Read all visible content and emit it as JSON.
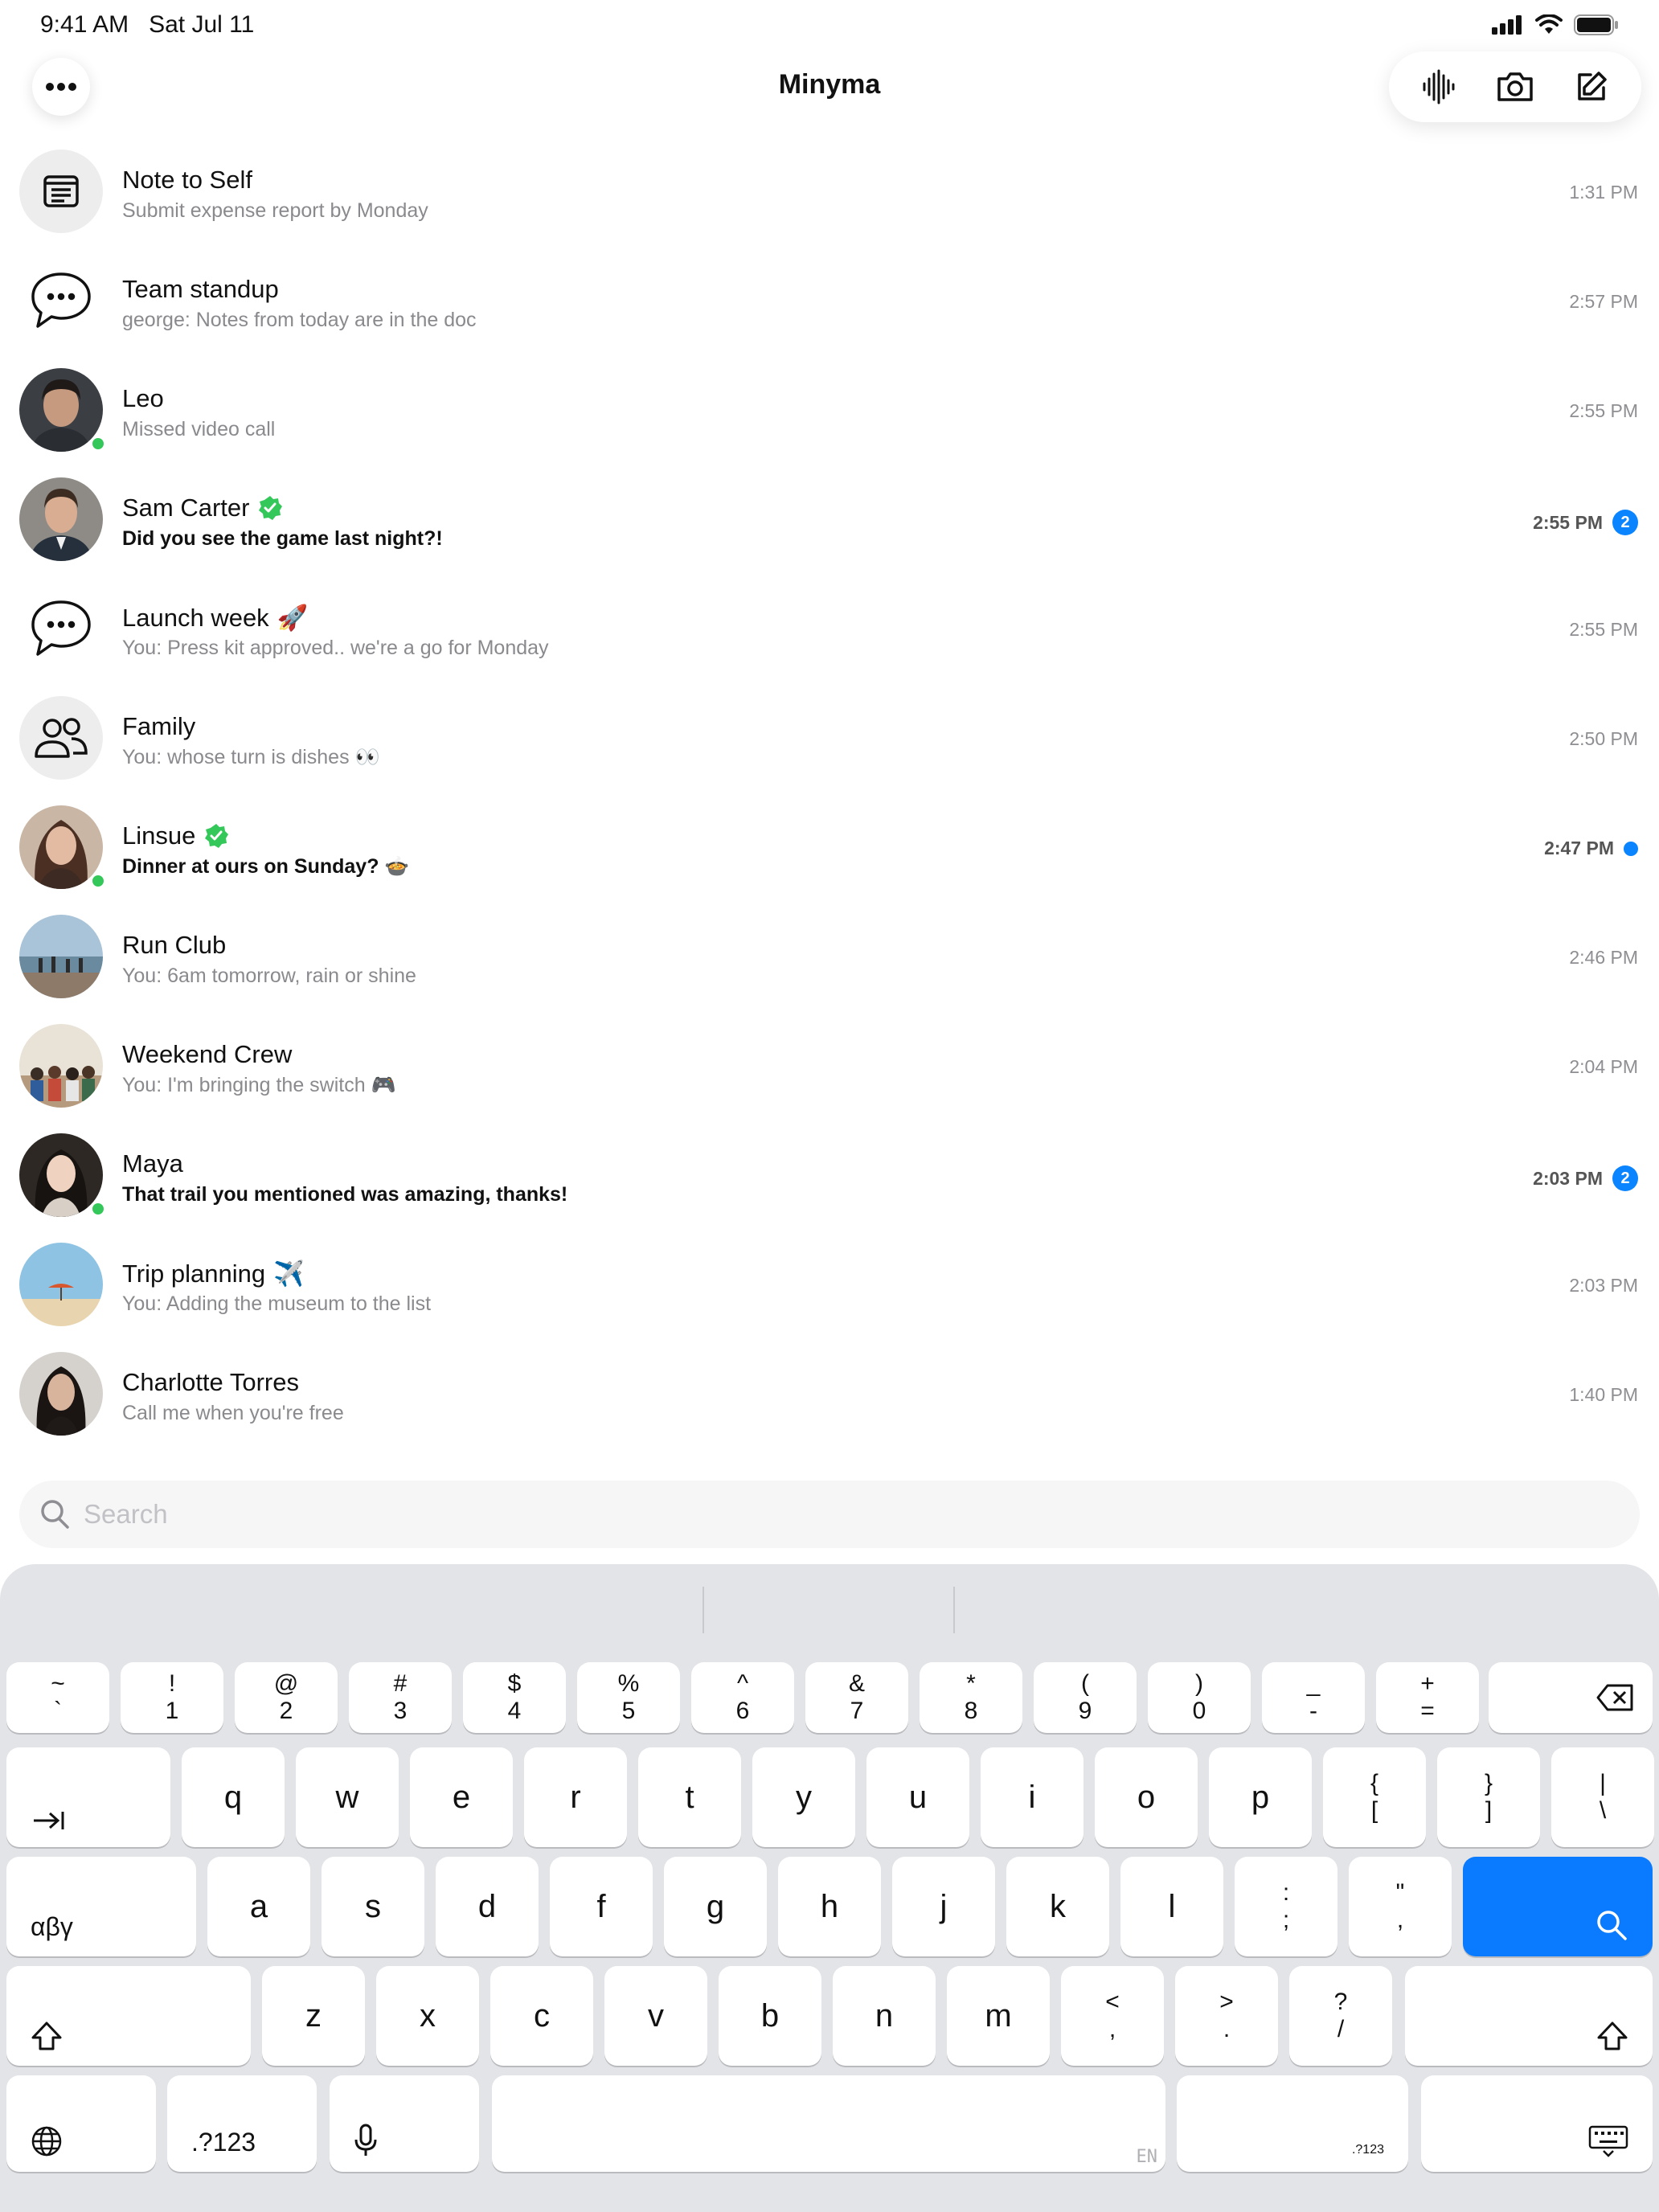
{
  "status_bar": {
    "time": "9:41 AM",
    "date": "Sat Jul 11"
  },
  "header": {
    "title": "Minyma",
    "menu_icon": "more-horizontal-icon",
    "toolbar_icons": [
      "waveform-icon",
      "camera-icon",
      "compose-icon"
    ]
  },
  "chats": [
    {
      "name": "Note to Self",
      "emoji": "",
      "preview": "Submit expense report by Monday",
      "time": "1:31 PM",
      "unread_count": "",
      "unread_dot": false,
      "verified": false,
      "online": false,
      "avatar": "note-icon",
      "bold": false
    },
    {
      "name": "Team standup",
      "emoji": "",
      "preview": "george: Notes from today are in the doc",
      "time": "2:57 PM",
      "unread_count": "",
      "unread_dot": false,
      "verified": false,
      "online": false,
      "avatar": "chat-bubble-icon",
      "bold": false
    },
    {
      "name": "Leo",
      "emoji": "",
      "preview": "Missed video call",
      "time": "2:55 PM",
      "unread_count": "",
      "unread_dot": false,
      "verified": false,
      "online": true,
      "avatar": "photo",
      "bold": false
    },
    {
      "name": "Sam Carter",
      "emoji": "",
      "preview": "Did you see the game last night?!",
      "time": "2:55 PM",
      "unread_count": "2",
      "unread_dot": false,
      "verified": true,
      "online": false,
      "avatar": "photo",
      "bold": true
    },
    {
      "name": "Launch week",
      "emoji": "🚀",
      "preview": "You: Press kit approved.. we're a go for Monday",
      "time": "2:55 PM",
      "unread_count": "",
      "unread_dot": false,
      "verified": false,
      "online": false,
      "avatar": "chat-bubble-icon",
      "bold": false
    },
    {
      "name": "Family",
      "emoji": "",
      "preview": "You: whose turn is dishes 👀",
      "time": "2:50 PM",
      "unread_count": "",
      "unread_dot": false,
      "verified": false,
      "online": false,
      "avatar": "group-icon",
      "bold": false
    },
    {
      "name": "Linsue",
      "emoji": "",
      "preview": "Dinner at ours on Sunday? 🍲",
      "time": "2:47 PM",
      "unread_count": "",
      "unread_dot": true,
      "verified": true,
      "online": true,
      "avatar": "photo",
      "bold": true
    },
    {
      "name": "Run Club",
      "emoji": "",
      "preview": "You: 6am tomorrow, rain or shine",
      "time": "2:46 PM",
      "unread_count": "",
      "unread_dot": false,
      "verified": false,
      "online": false,
      "avatar": "photo",
      "bold": false
    },
    {
      "name": "Weekend Crew",
      "emoji": "",
      "preview": "You: I'm bringing the switch 🎮",
      "time": "2:04 PM",
      "unread_count": "",
      "unread_dot": false,
      "verified": false,
      "online": false,
      "avatar": "photo",
      "bold": false
    },
    {
      "name": "Maya",
      "emoji": "",
      "preview": "That trail you mentioned was amazing, thanks!",
      "time": "2:03 PM",
      "unread_count": "2",
      "unread_dot": false,
      "verified": false,
      "online": true,
      "avatar": "photo",
      "bold": true
    },
    {
      "name": "Trip planning",
      "emoji": "✈️",
      "preview": "You: Adding the museum to the list",
      "time": "2:03 PM",
      "unread_count": "",
      "unread_dot": false,
      "verified": false,
      "online": false,
      "avatar": "photo",
      "bold": false
    },
    {
      "name": "Charlotte Torres",
      "emoji": "",
      "preview": "Call me when you're free",
      "time": "1:40 PM",
      "unread_count": "",
      "unread_dot": false,
      "verified": false,
      "online": false,
      "avatar": "photo",
      "bold": false
    }
  ],
  "search": {
    "placeholder": "Search"
  },
  "keyboard": {
    "number_row": [
      [
        "~",
        "`"
      ],
      [
        "!",
        "1"
      ],
      [
        "@",
        "2"
      ],
      [
        "#",
        "3"
      ],
      [
        "$",
        "4"
      ],
      [
        "%",
        "5"
      ],
      [
        "^",
        "6"
      ],
      [
        "&",
        "7"
      ],
      [
        "*",
        "8"
      ],
      [
        "(",
        "9"
      ],
      [
        ")",
        "0"
      ],
      [
        "_",
        "-"
      ],
      [
        "+",
        "="
      ]
    ],
    "row_q": [
      "q",
      "w",
      "e",
      "r",
      "t",
      "y",
      "u",
      "i",
      "o",
      "p"
    ],
    "row_q_symbols": [
      [
        "{",
        "["
      ],
      [
        "}",
        "]"
      ],
      [
        "|",
        "\\"
      ]
    ],
    "row_a": [
      "a",
      "s",
      "d",
      "f",
      "g",
      "h",
      "j",
      "k",
      "l"
    ],
    "row_a_symbols": [
      [
        ":",
        ";"
      ],
      [
        "\"",
        ","
      ]
    ],
    "row_z": [
      "z",
      "x",
      "c",
      "v",
      "b",
      "n",
      "m"
    ],
    "row_z_symbols": [
      [
        "<",
        ","
      ],
      [
        ">",
        "."
      ],
      [
        "?",
        "/"
      ]
    ],
    "greek_label": "αβγ",
    "numbers_label": ".?123",
    "language": "EN"
  }
}
